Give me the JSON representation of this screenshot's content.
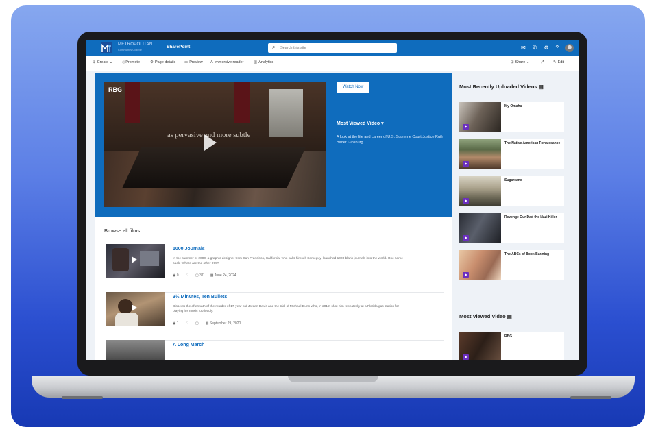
{
  "suite": {
    "org_name": "METROPOLITAN",
    "org_sub": "Community College",
    "app_name": "SharePoint",
    "search_placeholder": "Search this site",
    "waffle_icon": "waffle-icon",
    "icons": [
      "chat-icon",
      "megaphone-icon",
      "settings-icon",
      "help-icon"
    ]
  },
  "command_bar": {
    "create": "Create",
    "promote": "Promote",
    "page_details": "Page details",
    "preview": "Preview",
    "immersive_reader": "Immersive reader",
    "analytics": "Analytics",
    "share": "Share",
    "edit": "Edit"
  },
  "hero": {
    "video_label": "RBG",
    "video_caption": "as pervasive and more subtle",
    "watch_button": "Watch Now",
    "section_title": "Most Viewed Video",
    "description": "A look at the life and career of U.S. Supreme Court Justice Ruth Bader Ginsburg."
  },
  "browse": {
    "heading": "Browse all films",
    "films": [
      {
        "title": "1000 Journals",
        "description": "In the summer of 2000, a graphic designer from San Francisco, California, who calls himself Someguy, launched 1000 blank journals into the world. One came back. Where are the other 999?",
        "likes": "0",
        "comments": "37",
        "date": "June 24, 2024"
      },
      {
        "title": "3½ Minutes, Ten Bullets",
        "description": "Dissects the aftermath of the murder of 17-year-old Jordan Davis and the trial of Michael Dunn who, in 2012, shot him repeatedly at a Florida gas station for playing his music too loudly.",
        "likes": "1",
        "comments": "",
        "date": "September 29, 2020"
      },
      {
        "title": "A Long March",
        "description": "",
        "likes": "",
        "comments": "",
        "date": ""
      }
    ]
  },
  "rail": {
    "recent_heading": "Most Recently Uploaded Videos",
    "recent": [
      {
        "title": "My Omaha"
      },
      {
        "title": "The Native American Renaissance"
      },
      {
        "title": "Sugarcane"
      },
      {
        "title": "Revenge Our Dad the Nazi Killer"
      },
      {
        "title": "The ABCs of Book Banning"
      }
    ],
    "most_viewed_heading": "Most Viewed Video",
    "most_viewed": [
      {
        "title": "RBG"
      }
    ]
  }
}
